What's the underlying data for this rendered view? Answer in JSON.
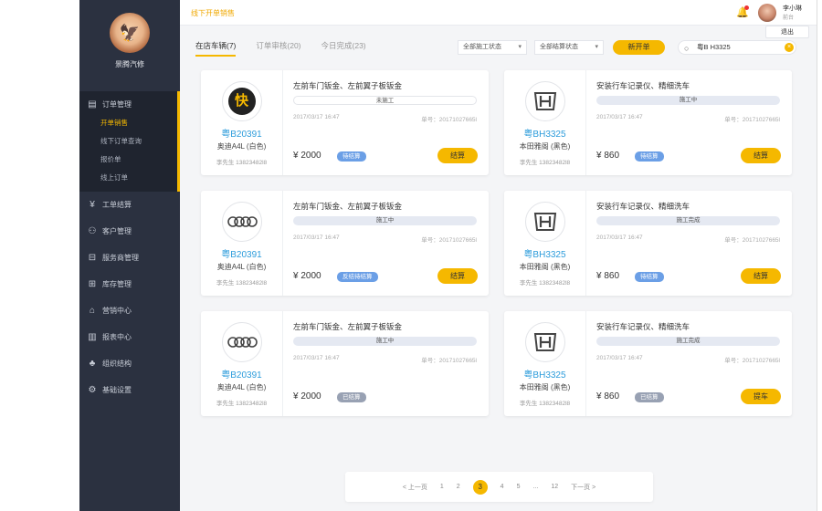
{
  "sidebar": {
    "brand_name": "景腾汽修",
    "logo_glyph": "🦅",
    "section": {
      "label": "订单管理",
      "icon": "order-icon"
    },
    "subitems": [
      "开单销售",
      "线下订单查询",
      "报价单",
      "线上订单"
    ],
    "items": [
      {
        "label": "工单结算",
        "icon": "yen-icon",
        "glyph": "¥"
      },
      {
        "label": "客户管理",
        "icon": "user-icon",
        "glyph": "⚇"
      },
      {
        "label": "服务商管理",
        "icon": "merchant-icon",
        "glyph": "⊟"
      },
      {
        "label": "库存管理",
        "icon": "inventory-icon",
        "glyph": "⊞"
      },
      {
        "label": "营销中心",
        "icon": "gift-icon",
        "glyph": "⌂"
      },
      {
        "label": "报表中心",
        "icon": "report-icon",
        "glyph": "▥"
      },
      {
        "label": "组织结构",
        "icon": "org-icon",
        "glyph": "♣"
      },
      {
        "label": "基础设置",
        "icon": "settings-icon",
        "glyph": "⚙"
      }
    ]
  },
  "header": {
    "breadcrumb": "线下开单销售",
    "user_name": "李小琳",
    "user_role": "前台",
    "logout": "退出"
  },
  "tabs": [
    "在店车辆(7)",
    "订单审核(20)",
    "今日完成(23)"
  ],
  "filters": {
    "status1": "全部施工状态",
    "status2": "全部结算状态",
    "new_order": "新开单",
    "search_value": "粤B H3325"
  },
  "cards": [
    {
      "logo": "kuai",
      "plate": "粤B20391",
      "model": "奥迪A4L (白色)",
      "owner": "李先生  13823482l8",
      "title": "左前车门钣金、左前翼子板钣金",
      "status": "未施工",
      "date": "2017/03/17  16:47",
      "order_no": "单号：20171027665l",
      "price": "¥ 2000",
      "badge": "待结算",
      "badge_style": "blue",
      "action": "结算"
    },
    {
      "logo": "honda",
      "plate": "粤BH3325",
      "model": "本田雅阁 (黑色)",
      "owner": "李先生  13823482l8",
      "title": "安装行车记录仪、精细洗车",
      "status": "施工中",
      "date": "2017/03/17  16:47",
      "order_no": "单号：20171027665l",
      "price": "¥ 860",
      "badge": "待结算",
      "badge_style": "blue",
      "action": "结算"
    },
    {
      "logo": "audi",
      "plate": "粤B20391",
      "model": "奥迪A4L (白色)",
      "owner": "李先生  13823482l8",
      "title": "左前车门钣金、左前翼子板钣金",
      "status": "施工中",
      "date": "2017/03/17  16:47",
      "order_no": "单号：20171027665l",
      "price": "¥ 2000",
      "badge": "反结待结算",
      "badge_style": "blue",
      "action": "结算"
    },
    {
      "logo": "honda",
      "plate": "粤BH3325",
      "model": "本田雅阁 (黑色)",
      "owner": "李先生  13823482l8",
      "title": "安装行车记录仪、精细洗车",
      "status": "施工完成",
      "date": "2017/03/17  16:47",
      "order_no": "单号：20171027665l",
      "price": "¥ 860",
      "badge": "待结算",
      "badge_style": "blue",
      "action": "结算"
    },
    {
      "logo": "audi",
      "plate": "粤B20391",
      "model": "奥迪A4L (白色)",
      "owner": "李先生  13823482l8",
      "title": "左前车门钣金、左前翼子板钣金",
      "status": "施工中",
      "date": "2017/03/17  16:47",
      "order_no": "单号：20171027665l",
      "price": "¥ 2000",
      "badge": "已结算",
      "badge_style": "gray",
      "action": ""
    },
    {
      "logo": "honda",
      "plate": "粤BH3325",
      "model": "本田雅阁 (黑色)",
      "owner": "李先生  13823482l8",
      "title": "安装行车记录仪、精细洗车",
      "status": "施工完成",
      "date": "2017/03/17  16:47",
      "order_no": "单号：20171027665l",
      "price": "¥ 860",
      "badge": "已结算",
      "badge_style": "gray",
      "action": "提车"
    }
  ],
  "pager": {
    "prev": "< 上一页",
    "pages": [
      "1",
      "2",
      "3",
      "4",
      "5",
      "...",
      "12"
    ],
    "current": "3",
    "next": "下一页 >"
  }
}
